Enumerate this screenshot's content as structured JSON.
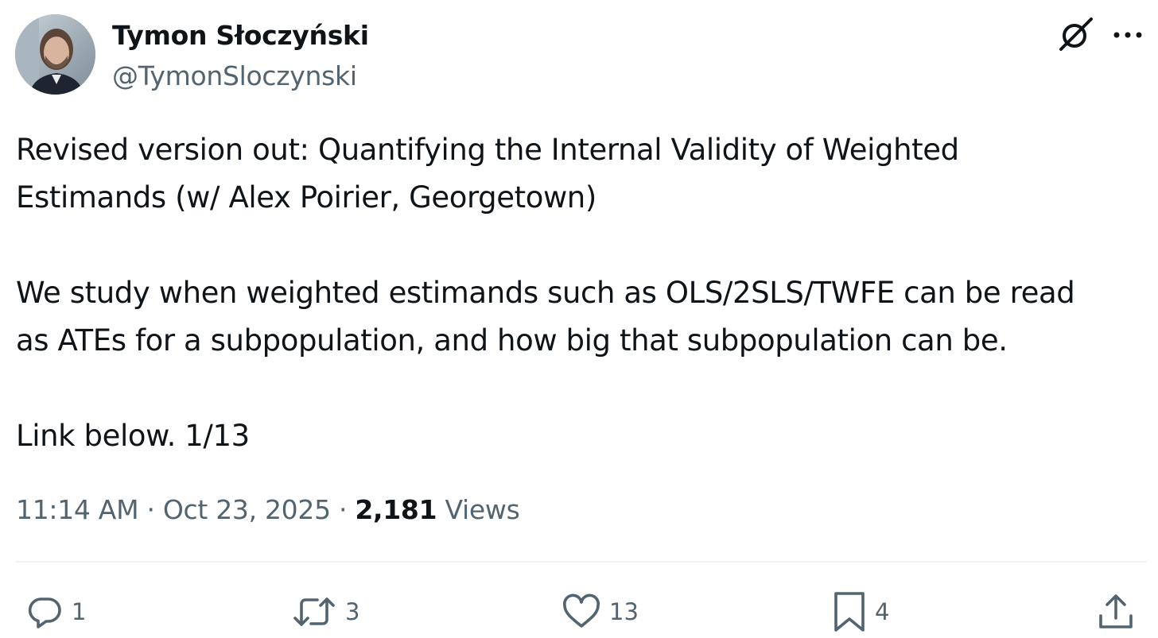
{
  "author": {
    "display_name": "Tymon Słoczyński",
    "handle": "@TymonSloczynski"
  },
  "tweet": {
    "paragraphs": [
      [
        "Revised version out: Quantifying the Internal Validity of Weighted",
        "Estimands (w/ Alex Poirier, Georgetown)"
      ],
      [
        "We study when weighted estimands such as OLS/2SLS/TWFE can be read",
        "as ATEs for a subpopulation, and how big that subpopulation can be."
      ],
      [
        "Link below. 1/13"
      ]
    ],
    "time": "11:14 AM",
    "separator": "·",
    "date": "Oct 23, 2025",
    "views_count": "2,181",
    "views_label": "Views"
  },
  "actions": {
    "reply_count": "1",
    "retweet_count": "3",
    "like_count": "13",
    "bookmark_count": "4"
  },
  "icons": {
    "avatar": "avatar-photo",
    "grok": "grok-icon",
    "more": "more-icon",
    "reply": "reply-icon",
    "retweet": "retweet-icon",
    "like": "heart-icon",
    "bookmark": "bookmark-icon",
    "share": "share-icon"
  },
  "colors": {
    "text_primary": "#0f1419",
    "text_secondary": "#536471",
    "divider": "#eff3f4"
  }
}
